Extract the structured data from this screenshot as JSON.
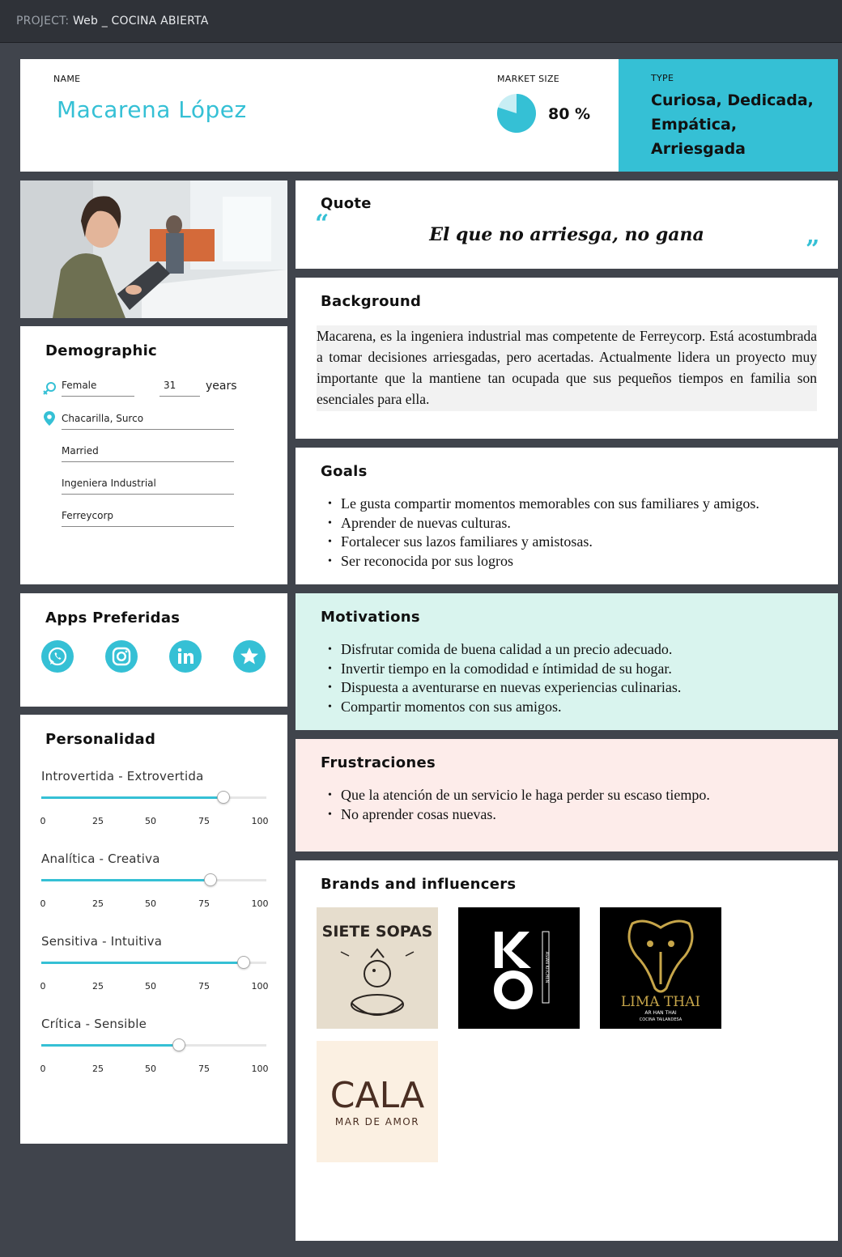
{
  "project": {
    "prefix": "PROJECT:",
    "name": "Web _ COCINA ABIERTA"
  },
  "header": {
    "name_label": "NAME",
    "name": "Macarena López",
    "market_label": "MARKET SIZE",
    "market_value": "80 %",
    "market_fraction": 0.8,
    "type_label": "TYPE",
    "type_value": "Curiosa, Dedicada, Empática, Arriesgada"
  },
  "colors": {
    "accent": "#35c0d5",
    "background": "#40444c",
    "topbar": "#2f3238",
    "motivations_bg": "#d9f4ee",
    "frustrations_bg": "#fdecea"
  },
  "demographic": {
    "title": "Demographic",
    "gender": "Female",
    "age": "31",
    "age_unit": "years",
    "location": "Chacarilla, Surco",
    "status": "Married",
    "profession": "Ingeniera Industrial",
    "company": "Ferreycorp",
    "icons": [
      "gender-icon",
      "location-pin-icon"
    ]
  },
  "apps": {
    "title": "Apps Preferidas",
    "items": [
      "whatsapp-icon",
      "instagram-icon",
      "linkedin-icon",
      "star-icon"
    ]
  },
  "personality": {
    "title": "Personalidad",
    "ticks": [
      "0",
      "25",
      "50",
      "75",
      "100"
    ],
    "sliders": [
      {
        "label": "Introvertida - Extrovertida",
        "value": 81
      },
      {
        "label": "Analítica - Creativa",
        "value": 75
      },
      {
        "label": "Sensitiva - Intuitiva",
        "value": 90
      },
      {
        "label": "Crítica - Sensible",
        "value": 61
      }
    ]
  },
  "quote": {
    "title": "Quote",
    "open": "“",
    "text": "El que no arriesga, no gana",
    "close": "”"
  },
  "background": {
    "title": "Background",
    "text": "Macarena, es la ingeniera industrial mas competente de Ferreycorp. Está acostumbrada a tomar decisiones arriesgadas, pero acertadas. Actualmente lidera un proyecto muy importante que la mantiene tan ocupada que sus pequeños tiempos en familia son esenciales para ella."
  },
  "goals": {
    "title": "Goals",
    "items": [
      "Le gusta compartir momentos memorables con sus familiares y amigos.",
      "Aprender de nuevas culturas.",
      "Fortalecer sus lazos familiares y amistosas.",
      "Ser reconocida por sus logros"
    ]
  },
  "motivations": {
    "title": "Motivations",
    "items": [
      "Disfrutar comida de buena calidad a un precio adecuado.",
      "Invertir tiempo en la comodidad e íntimidad de su hogar.",
      "Dispuesta a aventurarse en nuevas experiencias culinarias.",
      "Compartir momentos con sus amigos."
    ]
  },
  "frustrations": {
    "title": "Frustraciones",
    "items": [
      "Que la atención de un servicio le haga perder su escaso tiempo.",
      "No aprender cosas nuevas."
    ]
  },
  "brands": {
    "title": "Brands and influencers",
    "logos": [
      {
        "line1": "SIETE SOPAS"
      },
      {
        "main": "KO",
        "side": "ASIAN KITCHEN"
      },
      {
        "main": "LIMA THAI",
        "sub1": "AR HAN THAI",
        "sub2": "COCINA TAILANDESA"
      },
      {
        "main": "CALA",
        "sub": "MAR DE AMOR"
      }
    ]
  }
}
